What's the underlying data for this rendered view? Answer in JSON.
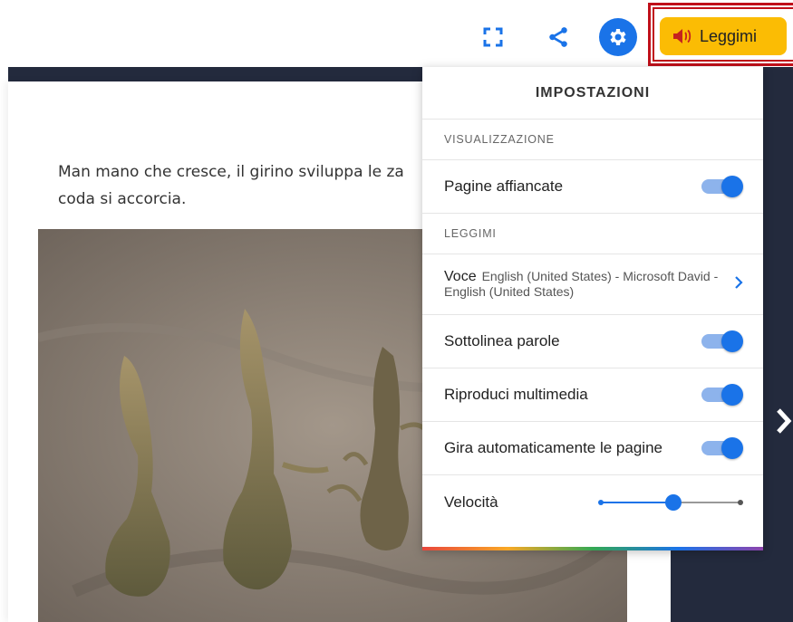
{
  "toolbar": {
    "fullscreen_icon": "fullscreen-icon",
    "share_icon": "share-icon",
    "settings_icon": "gear-icon",
    "read_aloud_label": "Leggimi",
    "read_aloud_icon": "speaker-icon",
    "read_aloud_color": "#fbbc04"
  },
  "page": {
    "text": "Man mano che cresce, il girino sviluppa le za\ncoda si accorcia."
  },
  "settings": {
    "title": "IMPOSTAZIONI",
    "display_section": "VISUALIZZAZIONE",
    "side_by_side_label": "Pagine affiancate",
    "side_by_side": true,
    "read_section": "LEGGIMI",
    "voice_key": "Voce",
    "voice_value": "English (United States) - Microsoft David - English (United States)",
    "underline_label": "Sottolinea parole",
    "underline": true,
    "media_label": "Riproduci multimedia",
    "media": true,
    "autoturn_label": "Gira automaticamente le pagine",
    "autoturn": true,
    "speed_label": "Velocità",
    "speed_level": 0.52
  },
  "colors": {
    "accent": "#1a73e8",
    "dark_background": "#232a3d",
    "highlight_outline": "#c0101a"
  }
}
